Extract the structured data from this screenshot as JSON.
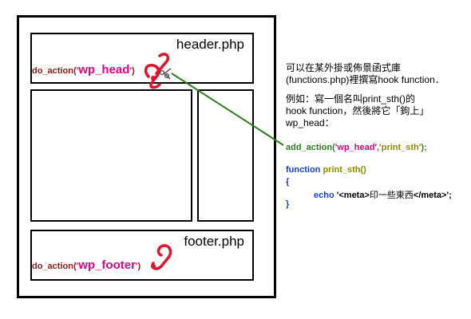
{
  "header": {
    "title": "header.php",
    "call_prefix": "do_action(",
    "call_quote_open": "'",
    "call_hook": "wp_head",
    "call_quote_close": "'",
    "call_suffix": ")"
  },
  "footer": {
    "title": "footer.php",
    "call_prefix": "do_action(",
    "call_quote_open": "'",
    "call_hook": "wp_footer",
    "call_quote_close": "'",
    "call_suffix": ")"
  },
  "description": {
    "line1": "可以在某外掛或佈景函式庫",
    "line2": "(functions.php)裡撰寫hook function．",
    "line3": "例如：寫一個名叫print_sth()的",
    "line4": "hook function，然後將它「鉤上」",
    "line5": "wp_head："
  },
  "code": {
    "add_action_prefix": "add_action(",
    "add_action_hook": "'wp_head'",
    "add_action_sep": ",",
    "add_action_func": "'print_sth'",
    "add_action_suffix": ");",
    "function_keyword": "function ",
    "function_name": "print_sth()",
    "brace_open": "{",
    "echo_keyword": "echo ",
    "echo_string_open": "'",
    "echo_tag_open": "<meta>",
    "echo_text": "印一些東西",
    "echo_tag_close": "</meta>",
    "echo_string_close": "';",
    "brace_close": "}"
  },
  "colors": {
    "hook_red": "#e0112b",
    "connector_green": "#2e7d1e",
    "do_action_text": "#8b1a1a",
    "hook_name": "#e6007e",
    "keyword_blue": "#1a3fd0",
    "function_olive": "#8b8b00"
  },
  "icons": [
    "hook-icon",
    "scissors-icon"
  ]
}
